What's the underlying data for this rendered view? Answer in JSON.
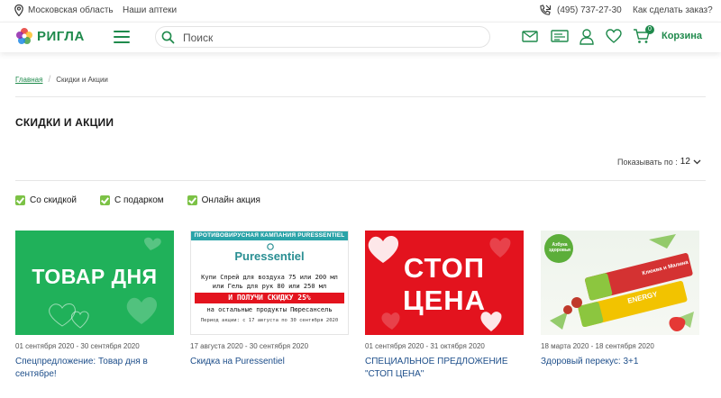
{
  "topbar": {
    "region": "Московская область",
    "pharmacies": "Наши аптеки",
    "phone": "(495) 737-27-30",
    "how_to_order": "Как сделать заказ?"
  },
  "header": {
    "logo_text": "РИГЛА",
    "search_placeholder": "Поиск",
    "cart_count": "0",
    "cart_label": "Корзина"
  },
  "breadcrumb": {
    "home": "Главная",
    "current": "Скидки и Акции"
  },
  "page_title": "СКИДКИ И АКЦИИ",
  "show_by": {
    "label": "Показывать по :",
    "value": "12"
  },
  "filters": [
    {
      "label": "Со скидкой",
      "checked": true
    },
    {
      "label": "С подарком",
      "checked": true
    },
    {
      "label": "Онлайн акция",
      "checked": true
    }
  ],
  "cards": [
    {
      "image_text": "ТОВАР ДНЯ",
      "date": "01 сентября 2020 - 30 сентября 2020",
      "title": "Спецпредложение: Товар дня в сентябре!"
    },
    {
      "image": {
        "top": "ПРОТИВОВИРУСНАЯ КАМПАНИЯ PURESSENTIEL",
        "logo": "Puressentiel",
        "line1": "Купи Спрей для воздуха 75 или 200 мл",
        "line2": "или Гель для рук 80 или 250 мл",
        "bar": "И ПОЛУЧИ СКИДКУ 25%",
        "line3": "на остальные продукты Пюресансель",
        "period": "Период акции: с 17 августа по 30 сентября 2020"
      },
      "date": "17 августа 2020 - 30 сентября 2020",
      "title": "Скидка на Puressentiel"
    },
    {
      "image_text_1": "СТОП",
      "image_text_2": "ЦЕНА",
      "date": "01 сентября 2020 - 31 октября 2020",
      "title": "СПЕЦИАЛЬНОЕ ПРЕДЛОЖЕНИЕ \"СТОП ЦЕНА\""
    },
    {
      "image": {
        "brand": "Азбука здоровья",
        "bar1": "Клюква и Малина",
        "bar2": "ENERGY"
      },
      "date": "18 марта 2020 - 18 сентября 2020",
      "title": "Здоровый перекус: 3+1"
    }
  ],
  "colors": {
    "brand_green": "#1f8a4c",
    "promo_green": "#20b15a",
    "promo_red": "#e3131e",
    "link_blue": "#1d4e8a",
    "checkbox_green": "#7cc246"
  }
}
